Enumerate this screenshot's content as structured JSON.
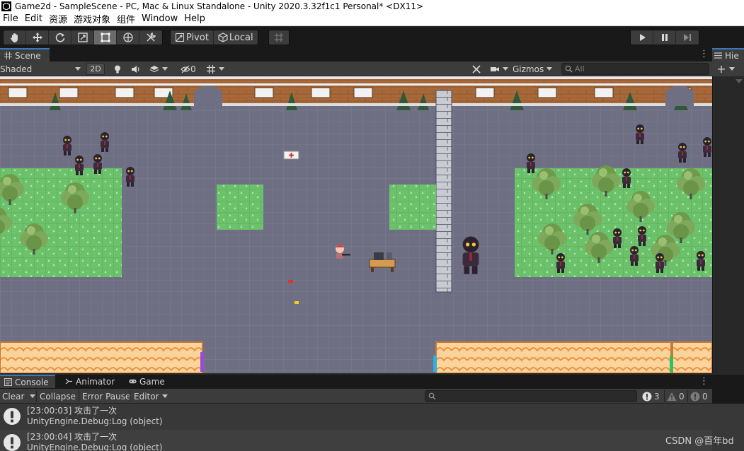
{
  "window": {
    "title": "Game2d - SampleScene - PC, Mac & Linux Standalone - Unity 2020.3.32f1c1 Personal* <DX11>"
  },
  "menu": {
    "items": [
      "File",
      "Edit",
      "资源",
      "游戏对象",
      "组件",
      "Window",
      "Help"
    ]
  },
  "toolbar": {
    "tools": [
      "hand-tool",
      "move-tool",
      "rotate-tool",
      "scale-tool",
      "rect-tool",
      "transform-tool",
      "custom-tool"
    ],
    "active_tool": "rect-tool",
    "pivot_label": "Pivot",
    "local_label": "Local"
  },
  "scene_window": {
    "tab_label": "Scene",
    "shading_mode": "Shaded",
    "mode_2d_label": "2D",
    "hidden_count": "0",
    "gizmos_label": "Gizmos",
    "search_placeholder": "All"
  },
  "hierarchy": {
    "tab_label": "Hie"
  },
  "console_window": {
    "tabs": [
      "Console",
      "Animator",
      "Game"
    ],
    "clear_label": "Clear",
    "collapse_label": "Collapse",
    "error_pause_label": "Error Pause",
    "editor_label": "Editor",
    "info_count": "3",
    "warning_count": "0",
    "error_count": "0",
    "logs": [
      {
        "message": "[23:00:03] 攻击了一次",
        "detail": "UnityEngine.Debug:Log (object)"
      },
      {
        "message": "[23:00:04] 攻击了一次",
        "detail": "UnityEngine.Debug:Log (object)"
      }
    ]
  },
  "watermark": "CSDN @百年bd",
  "colors": {
    "accent": "#3a79bb",
    "panel_bg": "#3c3c3c",
    "scene_floor": "#6e6f83",
    "grass": "#6cc26a"
  }
}
